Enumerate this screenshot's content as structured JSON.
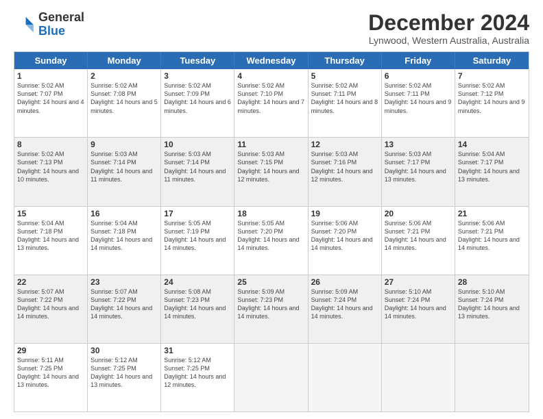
{
  "header": {
    "logo_general": "General",
    "logo_blue": "Blue",
    "month_title": "December 2024",
    "location": "Lynwood, Western Australia, Australia"
  },
  "weekdays": [
    "Sunday",
    "Monday",
    "Tuesday",
    "Wednesday",
    "Thursday",
    "Friday",
    "Saturday"
  ],
  "weeks": [
    [
      {
        "day": "1",
        "sunrise": "5:02 AM",
        "sunset": "7:07 PM",
        "daylight": "14 hours and 4 minutes."
      },
      {
        "day": "2",
        "sunrise": "5:02 AM",
        "sunset": "7:08 PM",
        "daylight": "14 hours and 5 minutes."
      },
      {
        "day": "3",
        "sunrise": "5:02 AM",
        "sunset": "7:09 PM",
        "daylight": "14 hours and 6 minutes."
      },
      {
        "day": "4",
        "sunrise": "5:02 AM",
        "sunset": "7:10 PM",
        "daylight": "14 hours and 7 minutes."
      },
      {
        "day": "5",
        "sunrise": "5:02 AM",
        "sunset": "7:11 PM",
        "daylight": "14 hours and 8 minutes."
      },
      {
        "day": "6",
        "sunrise": "5:02 AM",
        "sunset": "7:11 PM",
        "daylight": "14 hours and 9 minutes."
      },
      {
        "day": "7",
        "sunrise": "5:02 AM",
        "sunset": "7:12 PM",
        "daylight": "14 hours and 9 minutes."
      }
    ],
    [
      {
        "day": "8",
        "sunrise": "5:02 AM",
        "sunset": "7:13 PM",
        "daylight": "14 hours and 10 minutes."
      },
      {
        "day": "9",
        "sunrise": "5:03 AM",
        "sunset": "7:14 PM",
        "daylight": "14 hours and 11 minutes."
      },
      {
        "day": "10",
        "sunrise": "5:03 AM",
        "sunset": "7:14 PM",
        "daylight": "14 hours and 11 minutes."
      },
      {
        "day": "11",
        "sunrise": "5:03 AM",
        "sunset": "7:15 PM",
        "daylight": "14 hours and 12 minutes."
      },
      {
        "day": "12",
        "sunrise": "5:03 AM",
        "sunset": "7:16 PM",
        "daylight": "14 hours and 12 minutes."
      },
      {
        "day": "13",
        "sunrise": "5:03 AM",
        "sunset": "7:17 PM",
        "daylight": "14 hours and 13 minutes."
      },
      {
        "day": "14",
        "sunrise": "5:04 AM",
        "sunset": "7:17 PM",
        "daylight": "14 hours and 13 minutes."
      }
    ],
    [
      {
        "day": "15",
        "sunrise": "5:04 AM",
        "sunset": "7:18 PM",
        "daylight": "14 hours and 13 minutes."
      },
      {
        "day": "16",
        "sunrise": "5:04 AM",
        "sunset": "7:18 PM",
        "daylight": "14 hours and 14 minutes."
      },
      {
        "day": "17",
        "sunrise": "5:05 AM",
        "sunset": "7:19 PM",
        "daylight": "14 hours and 14 minutes."
      },
      {
        "day": "18",
        "sunrise": "5:05 AM",
        "sunset": "7:20 PM",
        "daylight": "14 hours and 14 minutes."
      },
      {
        "day": "19",
        "sunrise": "5:06 AM",
        "sunset": "7:20 PM",
        "daylight": "14 hours and 14 minutes."
      },
      {
        "day": "20",
        "sunrise": "5:06 AM",
        "sunset": "7:21 PM",
        "daylight": "14 hours and 14 minutes."
      },
      {
        "day": "21",
        "sunrise": "5:06 AM",
        "sunset": "7:21 PM",
        "daylight": "14 hours and 14 minutes."
      }
    ],
    [
      {
        "day": "22",
        "sunrise": "5:07 AM",
        "sunset": "7:22 PM",
        "daylight": "14 hours and 14 minutes."
      },
      {
        "day": "23",
        "sunrise": "5:07 AM",
        "sunset": "7:22 PM",
        "daylight": "14 hours and 14 minutes."
      },
      {
        "day": "24",
        "sunrise": "5:08 AM",
        "sunset": "7:23 PM",
        "daylight": "14 hours and 14 minutes."
      },
      {
        "day": "25",
        "sunrise": "5:09 AM",
        "sunset": "7:23 PM",
        "daylight": "14 hours and 14 minutes."
      },
      {
        "day": "26",
        "sunrise": "5:09 AM",
        "sunset": "7:24 PM",
        "daylight": "14 hours and 14 minutes."
      },
      {
        "day": "27",
        "sunrise": "5:10 AM",
        "sunset": "7:24 PM",
        "daylight": "14 hours and 14 minutes."
      },
      {
        "day": "28",
        "sunrise": "5:10 AM",
        "sunset": "7:24 PM",
        "daylight": "14 hours and 13 minutes."
      }
    ],
    [
      {
        "day": "29",
        "sunrise": "5:11 AM",
        "sunset": "7:25 PM",
        "daylight": "14 hours and 13 minutes."
      },
      {
        "day": "30",
        "sunrise": "5:12 AM",
        "sunset": "7:25 PM",
        "daylight": "14 hours and 13 minutes."
      },
      {
        "day": "31",
        "sunrise": "5:12 AM",
        "sunset": "7:25 PM",
        "daylight": "14 hours and 12 minutes."
      },
      null,
      null,
      null,
      null
    ]
  ]
}
